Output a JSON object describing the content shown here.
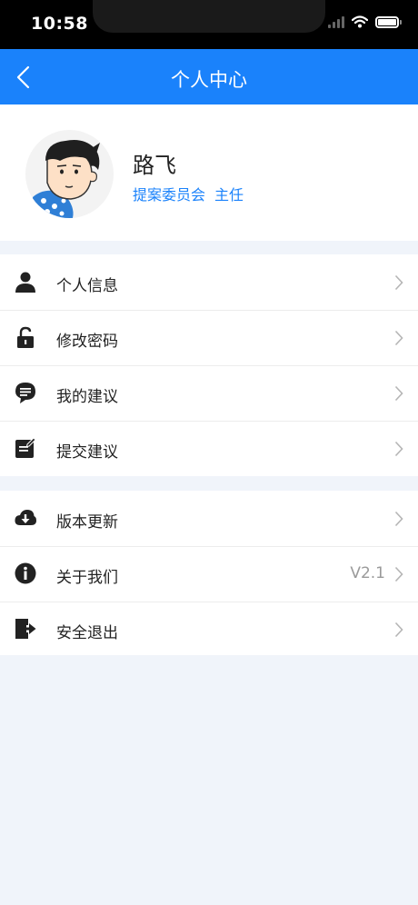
{
  "status_bar": {
    "time": "10:58"
  },
  "nav": {
    "title": "个人中心"
  },
  "profile": {
    "name": "路飞",
    "department": "提案委员会",
    "position": "主任"
  },
  "menu_group_1": [
    {
      "label": "个人信息",
      "icon": "user-icon"
    },
    {
      "label": "修改密码",
      "icon": "lock-icon"
    },
    {
      "label": "我的建议",
      "icon": "chat-icon"
    },
    {
      "label": "提交建议",
      "icon": "edit-icon"
    }
  ],
  "menu_group_2": [
    {
      "label": "版本更新",
      "icon": "cloud-download-icon"
    },
    {
      "label": "关于我们",
      "icon": "info-icon",
      "value": "V2.1"
    },
    {
      "label": "安全退出",
      "icon": "logout-icon"
    }
  ],
  "colors": {
    "accent": "#1a82fb",
    "background": "#f0f4fa"
  }
}
